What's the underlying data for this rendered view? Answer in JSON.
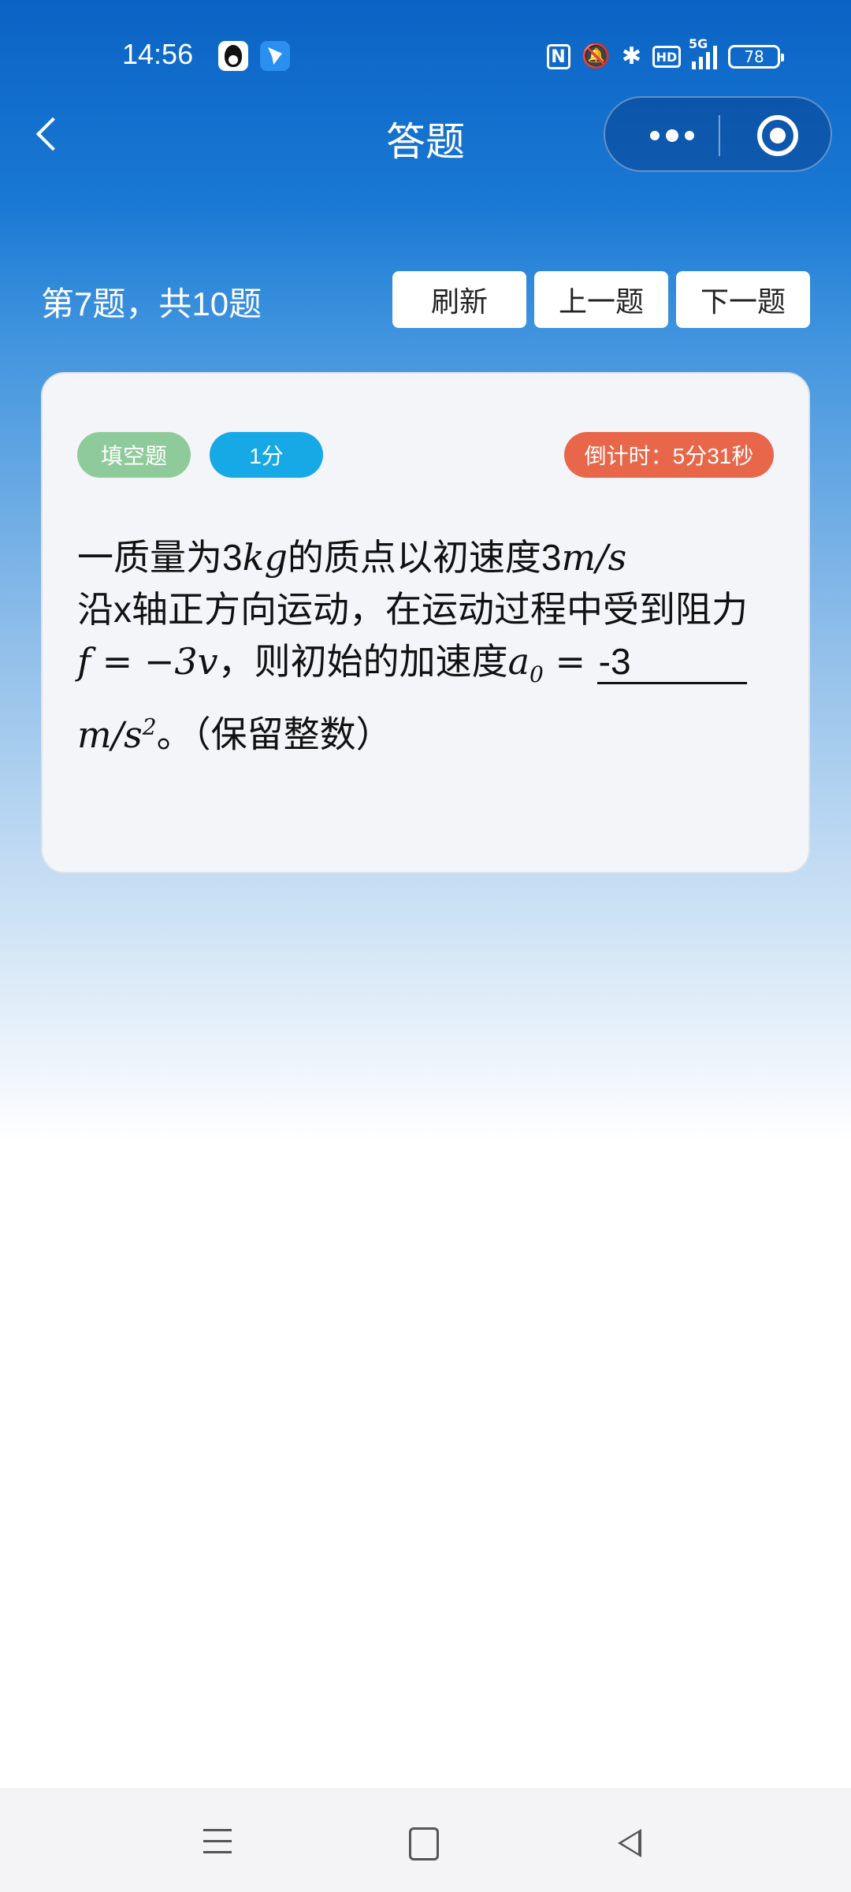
{
  "status_bar": {
    "time": "14:56",
    "network": "5G",
    "battery": "78"
  },
  "nav": {
    "title": "答题"
  },
  "quiz": {
    "counter": "第7题，共10题",
    "refresh_label": "刷新",
    "prev_label": "上一题",
    "next_label": "下一题"
  },
  "card": {
    "type_tag": "填空题",
    "score_tag": "1分",
    "timer_tag": "倒计时：5分31秒",
    "question": {
      "p1": "一质量为3",
      "m1": "kg",
      "p2": "的质点以初速度3",
      "m2": "m/s",
      "p3": "沿x轴正方向运动，在运动过程中受到阻力",
      "m3": "f = −3v",
      "p4": "，则初始的加速度",
      "m4": "a",
      "m4_sub": "0",
      "m5": " = ",
      "answer": "-3",
      "m6": "m/s",
      "m6_sup": "2",
      "p5": "。（保留整数）"
    }
  },
  "colors": {
    "header_blue": "#0a63c4",
    "type_tag": "#8fcb9a",
    "score_tag": "#17a8e6",
    "timer_tag": "#e8674a"
  }
}
